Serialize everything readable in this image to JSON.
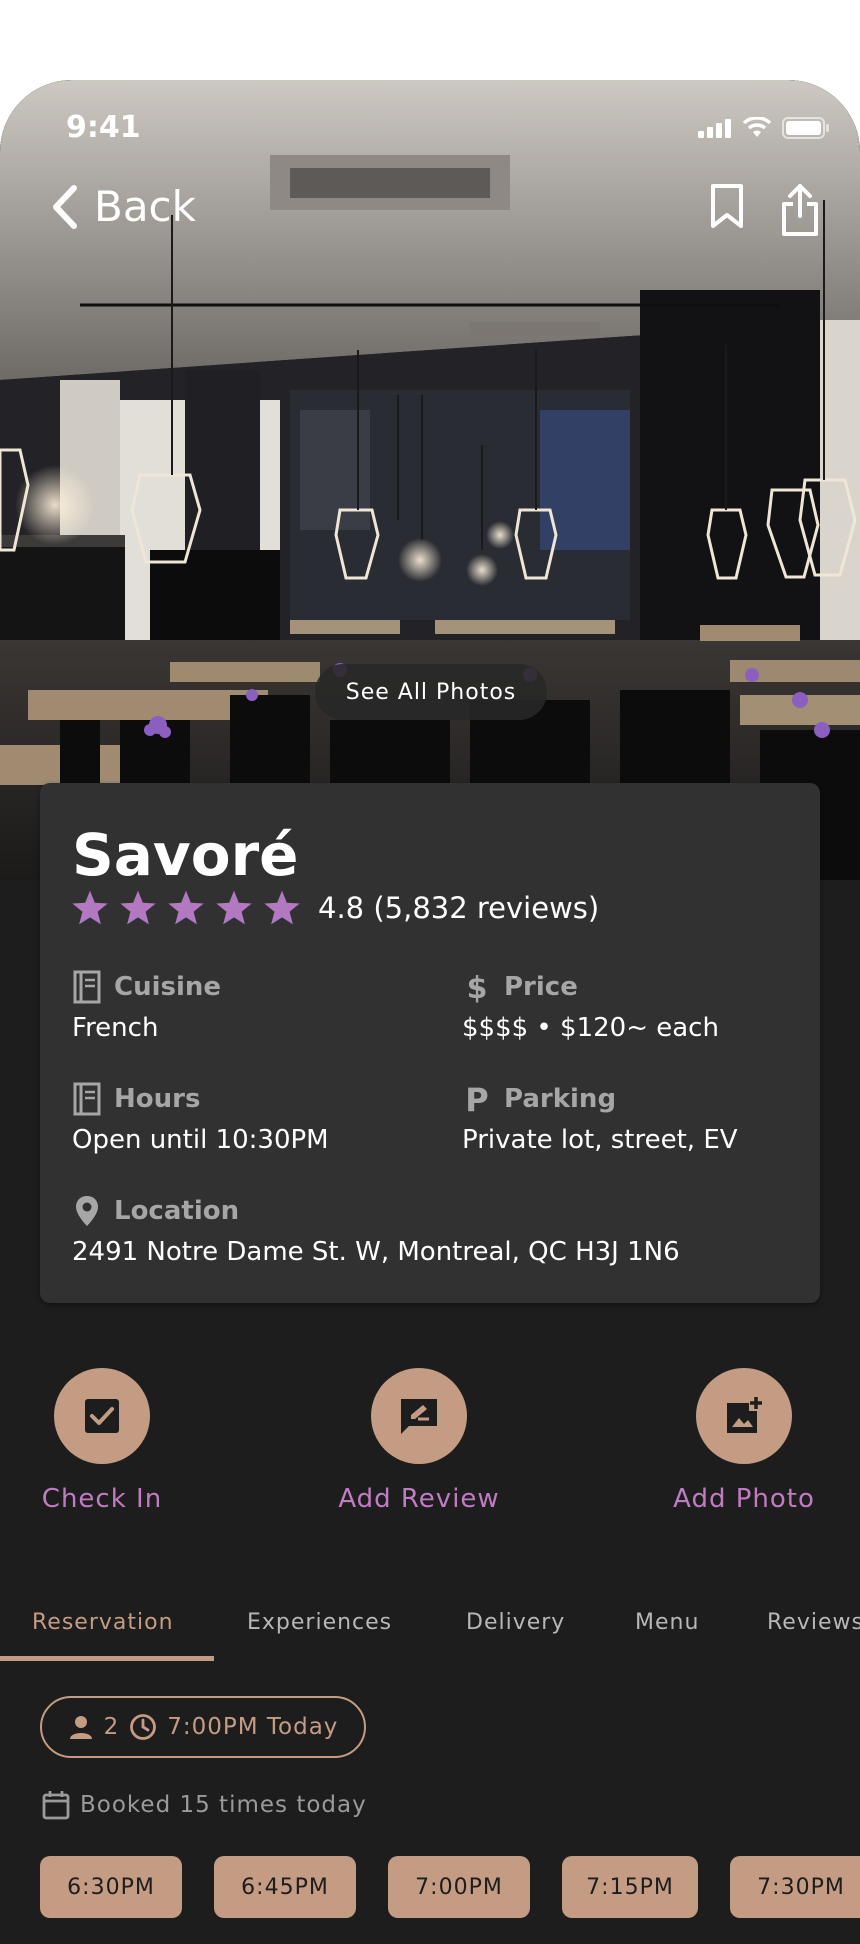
{
  "status_bar": {
    "time": "9:41",
    "icons": [
      "signal-icon",
      "wifi-icon",
      "battery-icon"
    ]
  },
  "nav": {
    "back_label": "Back",
    "bookmark_icon": "bookmark-icon",
    "share_icon": "share-icon"
  },
  "hero": {
    "see_all_photos": "See All Photos"
  },
  "restaurant": {
    "name": "Savoré",
    "rating_text": "4.8 (5,832 reviews)",
    "stars": 5,
    "cuisine": {
      "label": "Cuisine",
      "value": "French",
      "icon": "menu-book-icon"
    },
    "price": {
      "label": "Price",
      "value": "$$$$ • $120~ each",
      "icon": "dollar-icon"
    },
    "hours": {
      "label": "Hours",
      "value": "Open until 10:30PM",
      "icon": "menu-book-icon"
    },
    "parking": {
      "label": "Parking",
      "value": "Private lot, street, EV",
      "icon": "parking-icon"
    },
    "location": {
      "label": "Location",
      "value": "2491 Notre Dame St. W, Montreal, QC H3J 1N6",
      "icon": "location-pin-icon"
    }
  },
  "actions": [
    {
      "label": "Check In",
      "icon": "check-box-icon"
    },
    {
      "label": "Add Review",
      "icon": "rate-review-icon"
    },
    {
      "label": "Add Photo",
      "icon": "add-photo-icon"
    }
  ],
  "tabs": [
    "Reservation",
    "Experiences",
    "Delivery",
    "Menu",
    "Reviews"
  ],
  "active_tab": "Reservation",
  "reservation": {
    "party_size": "2",
    "time": "7:00PM Today",
    "booked_text": "Booked 15 times today",
    "slots": [
      "6:30PM",
      "6:45PM",
      "7:00PM",
      "7:15PM",
      "7:30PM"
    ]
  },
  "colors": {
    "accent": "#c49c83",
    "action_text": "#c07bc3",
    "star": "#b278c0",
    "background": "#1e1d1d",
    "card": "#313131"
  }
}
